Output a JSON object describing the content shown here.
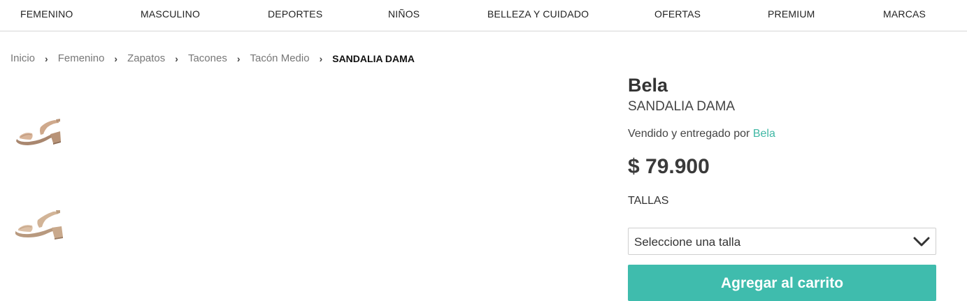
{
  "nav": {
    "items": [
      "FEMENINO",
      "MASCULINO",
      "DEPORTES",
      "NIÑOS",
      "BELLEZA Y CUIDADO",
      "OFERTAS",
      "PREMIUM",
      "MARCAS"
    ]
  },
  "breadcrumb": {
    "items": [
      "Inicio",
      "Femenino",
      "Zapatos",
      "Tacones",
      "Tacón Medio"
    ],
    "separator": "›",
    "current": "SANDALIA DAMA"
  },
  "thumbnails": [
    {
      "icon": "sandal-thumbnail-icon"
    },
    {
      "icon": "sandal-thumbnail-icon"
    }
  ],
  "product": {
    "brand": "Bela",
    "name": "SANDALIA DAMA",
    "seller_prefix": "Vendido y entregado por",
    "seller": "Bela",
    "price": "$ 79.900",
    "sizes_label": "TALLAS",
    "size_select_placeholder": "Seleccione una talla",
    "add_to_cart_label": "Agregar al carrito"
  },
  "colors": {
    "accent": "#3fbcad",
    "link": "#3fb7a4",
    "text": "#333333"
  }
}
